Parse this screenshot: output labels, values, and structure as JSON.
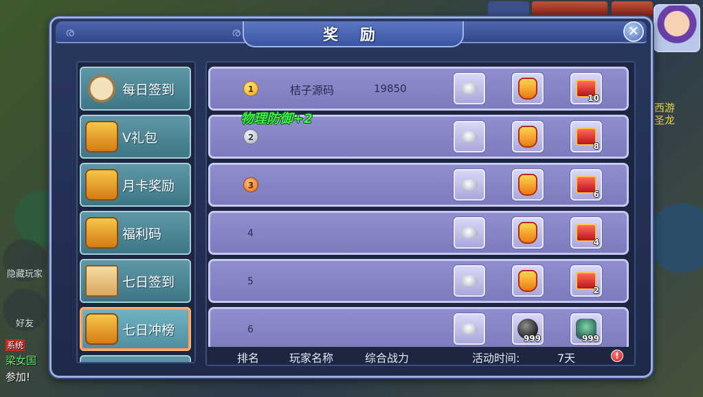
{
  "dialog": {
    "title": "奖 励",
    "close_icon": "close-icon"
  },
  "sidebar": {
    "items": [
      {
        "label": "每日签到",
        "icon": "scroll-icon",
        "active": false
      },
      {
        "label": "V礼包",
        "icon": "treasure-chest-icon",
        "active": false
      },
      {
        "label": "月卡奖励",
        "icon": "treasure-chest-icon",
        "active": false
      },
      {
        "label": "福利码",
        "icon": "treasure-chest-icon",
        "active": false
      },
      {
        "label": "七日签到",
        "icon": "map-scroll-icon",
        "active": false
      },
      {
        "label": "七日冲榜",
        "icon": "treasure-chest-icon",
        "active": true
      }
    ]
  },
  "ranking": {
    "rows": [
      {
        "rank": "1",
        "name": "桔子源码",
        "power": "19850",
        "rewards": [
          {
            "icon": "silver-ingot-icon"
          },
          {
            "icon": "gift-pouch-icon"
          },
          {
            "icon": "red-chest-icon",
            "qty": "10"
          }
        ]
      },
      {
        "rank": "2",
        "name": "",
        "power": "",
        "rewards": [
          {
            "icon": "silver-ingot-icon"
          },
          {
            "icon": "gift-pouch-icon"
          },
          {
            "icon": "red-chest-icon",
            "qty": "8"
          }
        ]
      },
      {
        "rank": "3",
        "name": "",
        "power": "",
        "rewards": [
          {
            "icon": "silver-ingot-icon"
          },
          {
            "icon": "gift-pouch-icon"
          },
          {
            "icon": "red-chest-icon",
            "qty": "6"
          }
        ]
      },
      {
        "rank": "4",
        "name": "",
        "power": "",
        "rewards": [
          {
            "icon": "silver-ingot-icon"
          },
          {
            "icon": "gift-pouch-icon"
          },
          {
            "icon": "red-chest-icon",
            "qty": "4"
          }
        ]
      },
      {
        "rank": "5",
        "name": "",
        "power": "",
        "rewards": [
          {
            "icon": "silver-ingot-icon"
          },
          {
            "icon": "gift-pouch-icon"
          },
          {
            "icon": "red-chest-icon",
            "qty": "2"
          }
        ]
      },
      {
        "rank": "6",
        "name": "",
        "power": "",
        "rewards": [
          {
            "icon": "silver-ingot-icon"
          },
          {
            "icon": "dark-stone-icon",
            "qty": "999"
          },
          {
            "icon": "mount-icon",
            "qty": "999"
          }
        ]
      }
    ],
    "footer": {
      "col_rank": "排名",
      "col_name": "玩家名称",
      "col_power": "综合战力",
      "time_label": "活动时间:",
      "time_value": "7天",
      "info_icon": "warning-icon"
    }
  },
  "floating_text": "物理防御+2",
  "background": {
    "hide_players": "隐藏玩家",
    "friends": "好友",
    "chat_tag": "系统",
    "chat_line1": "梁女国",
    "chat_line2": "参加!",
    "guild_text1": "西游",
    "guild_text2": "圣龙"
  },
  "colors": {
    "dialog_frame": "#9db0dc",
    "row_fill": "#8f8fd0",
    "sidebar_item": "#5f97a6",
    "active_border": "#ff9b5a",
    "float_text": "#3cf04a"
  }
}
